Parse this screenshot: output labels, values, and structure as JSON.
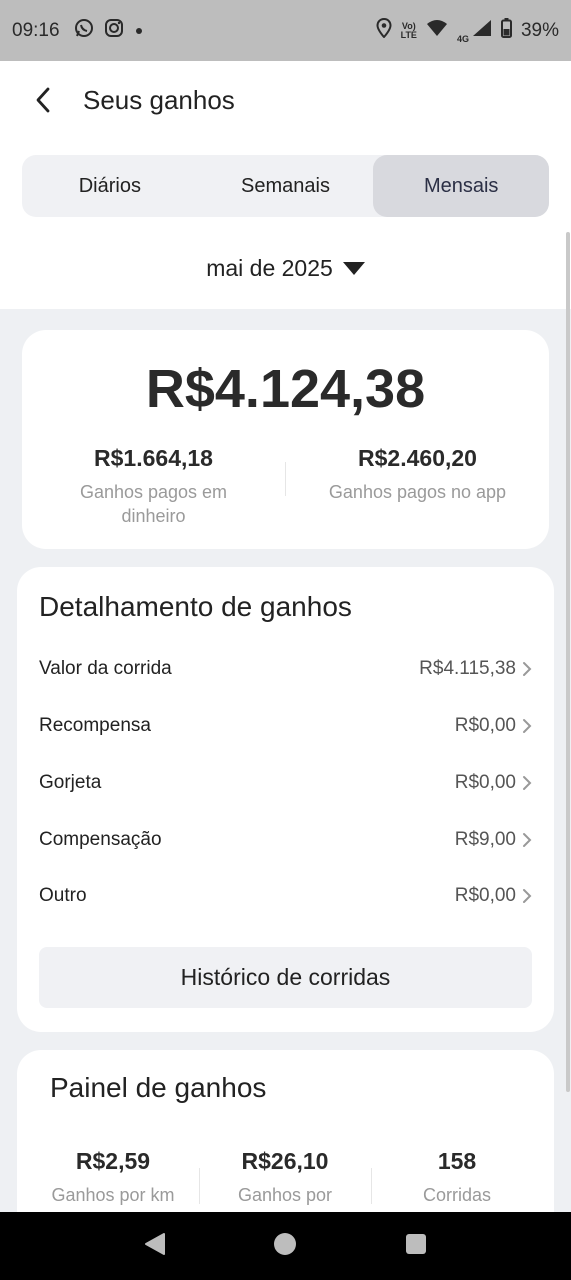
{
  "status_bar": {
    "time": "09:16",
    "lte_top": "Vo)",
    "lte_bottom": "LTE",
    "network": "4G",
    "battery": "39%"
  },
  "header": {
    "title": "Seus ganhos"
  },
  "tabs": [
    {
      "label": "Diários",
      "active": false
    },
    {
      "label": "Semanais",
      "active": false
    },
    {
      "label": "Mensais",
      "active": true
    }
  ],
  "month_selector": {
    "label": "mai de 2025"
  },
  "summary": {
    "total": "R$4.124,38",
    "cash": {
      "value": "R$1.664,18",
      "label": "Ganhos pagos em dinheiro"
    },
    "app": {
      "value": "R$2.460,20",
      "label": "Ganhos pagos no app"
    }
  },
  "detail": {
    "title": "Detalhamento de ganhos",
    "rows": [
      {
        "label": "Valor da corrida",
        "amount": "R$4.115,38"
      },
      {
        "label": "Recompensa",
        "amount": "R$0,00"
      },
      {
        "label": "Gorjeta",
        "amount": "R$0,00"
      },
      {
        "label": "Compensação",
        "amount": "R$9,00"
      },
      {
        "label": "Outro",
        "amount": "R$0,00"
      }
    ],
    "history_button": "Histórico de corridas"
  },
  "panel": {
    "title": "Painel de ganhos",
    "stats": [
      {
        "value": "R$2,59",
        "label": "Ganhos por km"
      },
      {
        "value": "R$26,10",
        "label": "Ganhos por"
      },
      {
        "value": "158",
        "label": "Corridas"
      }
    ]
  }
}
